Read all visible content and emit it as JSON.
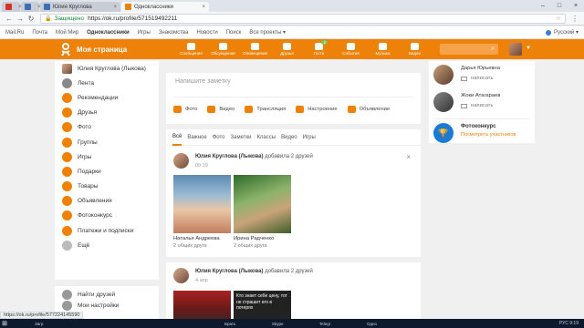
{
  "browser": {
    "tabs": [
      {
        "label": "",
        "color": "#d93025"
      },
      {
        "label": "",
        "color": "#3b6fb6"
      },
      {
        "label": "Юлия Круглова",
        "color": "#3b6fb6"
      },
      {
        "label": "Одноклассники",
        "color": "#ee8208",
        "active": true
      }
    ],
    "secure_label": "Защищено",
    "url": "https://ok.ru/profile/571519492211",
    "window_controls": [
      "–",
      "□",
      "×"
    ]
  },
  "top_links": [
    "Mail.Ru",
    "Почта",
    "Мой Мир",
    "Одноклассники",
    "Игры",
    "Знакомства",
    "Новости",
    "Поиск",
    "Все проекты ▾"
  ],
  "top_links_bold_index": 3,
  "language": "Русский ▾",
  "header": {
    "my_page": "Моя страница",
    "nav": [
      {
        "label": "Сообщения",
        "badge": ""
      },
      {
        "label": "Обсуждения",
        "badge": ""
      },
      {
        "label": "Оповещения",
        "badge": ""
      },
      {
        "label": "Друзья",
        "badge": ""
      },
      {
        "label": "Гости",
        "badge": "2"
      },
      {
        "label": "События",
        "badge": ""
      },
      {
        "label": "Музыка",
        "badge": ""
      },
      {
        "label": "Видео",
        "badge": ""
      }
    ],
    "search_placeholder": ""
  },
  "sidebar": {
    "items": [
      {
        "label": "Юлия Круглова (Лыкова)",
        "icon": "avatar",
        "color": "#999"
      },
      {
        "label": "Лента",
        "icon": "feed-icon",
        "color": "#888"
      },
      {
        "label": "Рекомендации",
        "icon": "star-icon",
        "color": "#ee8208"
      },
      {
        "label": "Друзья",
        "icon": "friends-icon",
        "color": "#ee8208"
      },
      {
        "label": "Фото",
        "icon": "camera-icon",
        "color": "#ee8208"
      },
      {
        "label": "Группы",
        "icon": "groups-icon",
        "color": "#ee8208"
      },
      {
        "label": "Игры",
        "icon": "games-icon",
        "color": "#ee8208"
      },
      {
        "label": "Подарки",
        "icon": "gift-icon",
        "color": "#ee8208"
      },
      {
        "label": "Товары",
        "icon": "cart-icon",
        "color": "#ee8208"
      },
      {
        "label": "Объявления",
        "icon": "ads-icon",
        "color": "#ee8208"
      },
      {
        "label": "Фотоконкурс",
        "icon": "trophy-icon",
        "color": "#ee8208"
      },
      {
        "label": "Платежи и подписки",
        "icon": "payment-icon",
        "color": "#ee8208"
      },
      {
        "label": "Ещё",
        "icon": "more-icon",
        "color": "#bbb"
      }
    ],
    "bottom": [
      {
        "label": "Найти друзей",
        "icon": "find-friends-icon"
      },
      {
        "label": "Мои настройки",
        "icon": "settings-icon"
      }
    ]
  },
  "postbox": {
    "placeholder": "Напишите заметку",
    "actions": [
      "Фото",
      "Видео",
      "Трансляция",
      "Настроение",
      "Объявление"
    ]
  },
  "feed": {
    "tabs": [
      "Всё",
      "Важное",
      "Фото",
      "Заметки",
      "Классы",
      "Видео",
      "Игры"
    ],
    "post1": {
      "author": "Юлия Круглова (Лыкова)",
      "action": "добавила 2 друзей",
      "time": "09:19",
      "friends": [
        {
          "name": "Наталья Андреева",
          "common": "2 общих друга"
        },
        {
          "name": "Ирина Радченко",
          "common": "2 общих друга"
        }
      ]
    },
    "post2": {
      "author": "Юлия Круглова (Лыкова)",
      "action": "добавила 2 друзей",
      "time": "4 апр",
      "image_text": "Кто знает себе цену, тот не страшит его в потерях"
    }
  },
  "right": {
    "friends": [
      {
        "name": "Дарья Юрьевна",
        "msg": "написать"
      },
      {
        "name": "Жоки Атагараев",
        "msg": "написать"
      }
    ],
    "contest": {
      "title": "Фотоконкурс",
      "link": "Посмотреть участников"
    }
  },
  "status_url": "https://ok.ru/profile/577224145590",
  "taskbar": {
    "items": [
      "",
      "Загр",
      "",
      "",
      "",
      "",
      "",
      "",
      "",
      "Брать",
      "",
      "Skype",
      "",
      "Telegr",
      "",
      "Одно"
    ],
    "tray": "РУС  9:19"
  }
}
